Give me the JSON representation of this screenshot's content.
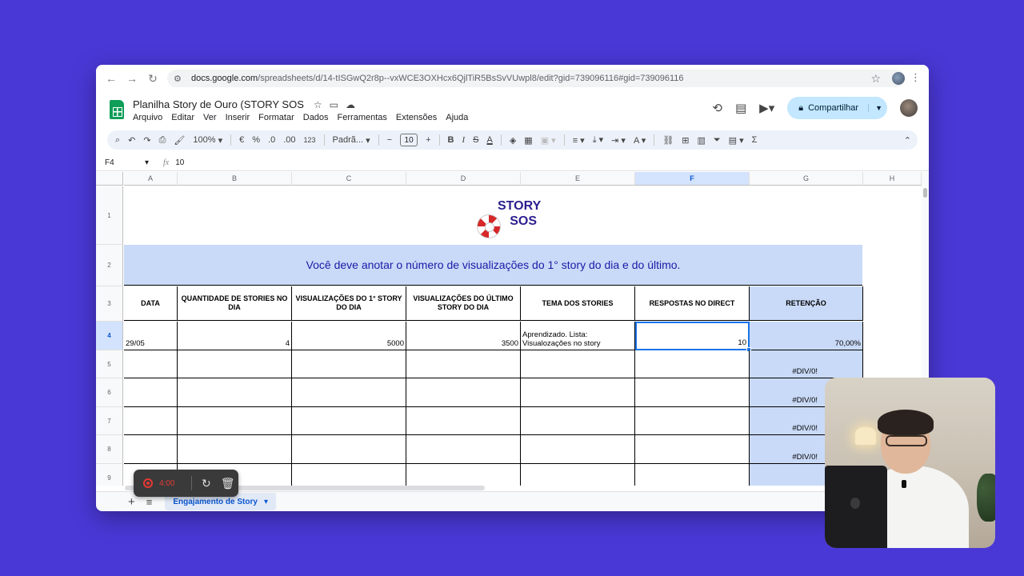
{
  "browser": {
    "url_host": "docs.google.com",
    "url_path": "/spreadsheets/d/14-tISGwQ2r8p--vxWCE3OXHcx6QjlTiR5BsSvVUwpl8/edit?gid=739096116#gid=739096116"
  },
  "doc": {
    "title": "Planilha Story de Ouro (STORY SOS",
    "share_label": "Compartilhar",
    "menu": [
      "Arquivo",
      "Editar",
      "Ver",
      "Inserir",
      "Formatar",
      "Dados",
      "Ferramentas",
      "Extensões",
      "Ajuda"
    ]
  },
  "toolbar": {
    "zoom": "100%",
    "currency": "€",
    "percent": "%",
    "dec_less": ".0",
    "dec_more": ".00",
    "number_format": "123",
    "font": "Padrã...",
    "font_size": "10"
  },
  "formula_bar": {
    "cell_ref": "F4",
    "fx": "fx",
    "value": "10"
  },
  "grid": {
    "columns": [
      "A",
      "B",
      "C",
      "D",
      "E",
      "F",
      "G",
      "H"
    ],
    "selected_column": "F",
    "rows": [
      "1",
      "2",
      "3",
      "4",
      "5",
      "6",
      "7",
      "8",
      "9"
    ],
    "selected_row": "4",
    "logo_line1": "STORY",
    "logo_line2": "SOS",
    "banner": "Você deve anotar o número de visualizações do 1° story do dia e do último.",
    "headers": [
      "DATA",
      "QUANTIDADE DE STORIES NO DIA",
      "VISUALIZAÇÕES DO 1° STORY DO DIA",
      "VISUALIZAÇÕES DO ÚLTIMO STORY DO DIA",
      "TEMA DOS STORIES",
      "RESPOSTAS NO DIRECT",
      "RETENÇÃO"
    ],
    "row4": [
      "29/05",
      "4",
      "5000",
      "3500",
      "Aprendizado. Lista: Visualozações no story",
      "10",
      "70,00%"
    ],
    "error_value": "#DIV/0!"
  },
  "sheet_tabs": {
    "active": "Engajamento de Story"
  },
  "recorder": {
    "time": "4:00"
  },
  "colors": {
    "background": "#4a38d6",
    "banner": "#c9daf8",
    "accent": "#1a73e8",
    "logo": "#2a1f8f"
  }
}
